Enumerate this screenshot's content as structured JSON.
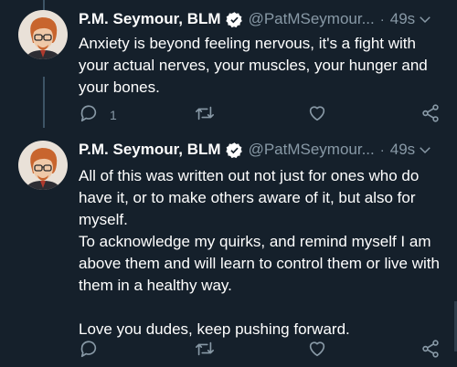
{
  "tweets": [
    {
      "name": "P.M. Seymour, BLM",
      "handle": "@PatMSeymour...",
      "separator": "·",
      "time": "49s",
      "text": "Anxiety is beyond feeling nervous, it's a fight with your actual nerves, your muscles, your hunger and your bones.",
      "reply_count": "1"
    },
    {
      "name": "P.M. Seymour, BLM",
      "handle": "@PatMSeymour...",
      "separator": "·",
      "time": "49s",
      "text": "All of this was written out not just for ones who do have it, or to make others aware of it, but also for myself.\nTo acknowledge my quirks, and remind myself I am above them and will learn to control them or live with them in a healthy way.\n\nLove you dudes, keep pushing forward.",
      "reply_count": ""
    }
  ],
  "colors": {
    "background": "#15202b",
    "text": "#ffffff",
    "secondary": "#8899a6",
    "verified": "#ffffff"
  },
  "icons": [
    "verified-badge-icon",
    "chevron-down-icon",
    "reply-icon",
    "retweet-icon",
    "like-icon",
    "share-icon"
  ]
}
